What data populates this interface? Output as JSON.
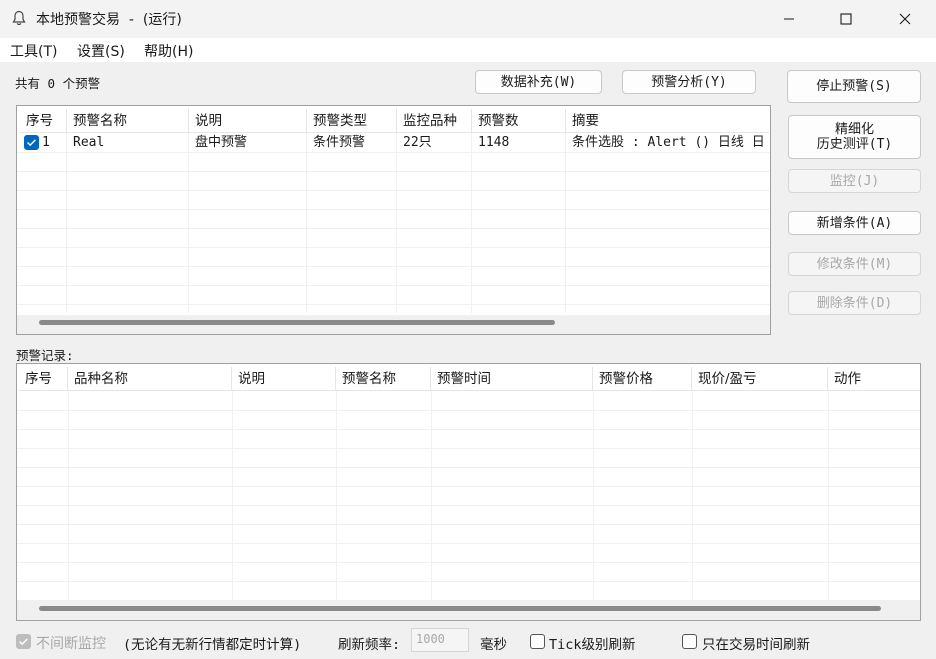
{
  "window": {
    "title": "本地预警交易  -  (运行)",
    "icon": "bell-icon",
    "controls": [
      "minimize-icon",
      "maximize-icon",
      "close-icon"
    ]
  },
  "menu": {
    "items": [
      "工具(T)",
      "设置(S)",
      "帮助(H)"
    ]
  },
  "summary": {
    "count_text": "共有 0 个预警"
  },
  "top_buttons": {
    "data_supplement": "数据补充(W)",
    "alert_analysis": "预警分析(Y)"
  },
  "side_buttons": {
    "stop_alert": "停止预警(S)",
    "refine_line1": "精细化",
    "refine_line2": "历史测评(T)",
    "monitor": "监控(J)",
    "add_condition": "新增条件(A)",
    "modify_condition": "修改条件(M)",
    "delete_condition": "删除条件(D)"
  },
  "alerts_table": {
    "columns": [
      "序号",
      "预警名称",
      "说明",
      "预警类型",
      "监控品种",
      "预警数",
      "摘要"
    ],
    "rows": [
      {
        "checked": true,
        "index": "1",
        "name": "Real",
        "desc": "盘中预警",
        "type": "条件预警",
        "symbols": "22只",
        "count": "1148",
        "summary": "条件选股 : Alert () 日线 日"
      }
    ]
  },
  "records": {
    "label": "预警记录:",
    "columns": [
      "序号",
      "品种名称",
      "说明",
      "预警名称",
      "预警时间",
      "预警价格",
      "现价/盈亏",
      "动作"
    ]
  },
  "footer": {
    "nonstop_label": "不间断监控",
    "nonstop_note": "(无论有无新行情都定时计算)",
    "refresh_label": "刷新频率:",
    "refresh_value": "1000",
    "refresh_unit": "毫秒",
    "tick_refresh": "Tick级别刷新",
    "trade_time_only": "只在交易时间刷新"
  },
  "colors": {
    "accent": "#0067c0",
    "disabled_text": "#a8a8a8",
    "scrollbar": "#8a8a8a"
  }
}
